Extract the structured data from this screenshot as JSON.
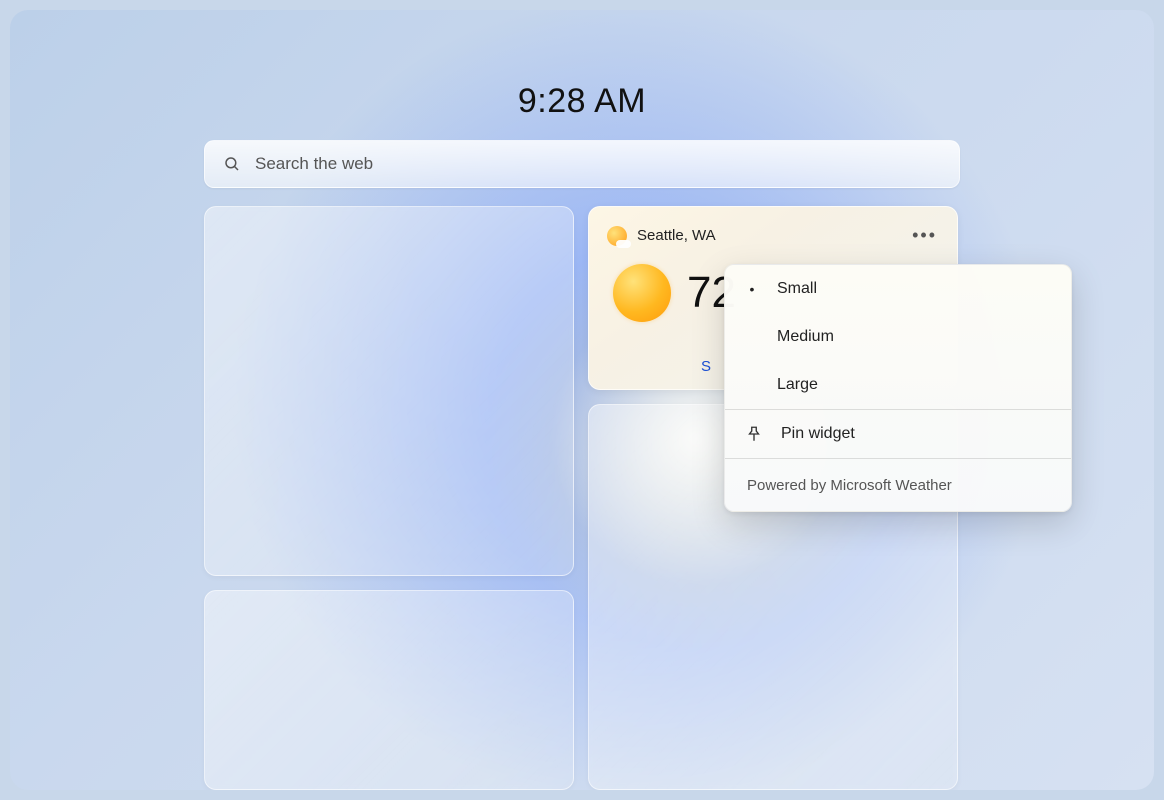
{
  "clock": {
    "time": "9:28 AM"
  },
  "search": {
    "placeholder": "Search the web"
  },
  "weather": {
    "location": "Seattle, WA",
    "temperature": "72",
    "details_link_visible": "S",
    "icon": "partly-sunny-icon"
  },
  "menu": {
    "size_options": [
      {
        "label": "Small",
        "selected": true
      },
      {
        "label": "Medium",
        "selected": false
      },
      {
        "label": "Large",
        "selected": false
      }
    ],
    "pin_label": "Pin widget",
    "footer": "Powered by Microsoft Weather"
  }
}
